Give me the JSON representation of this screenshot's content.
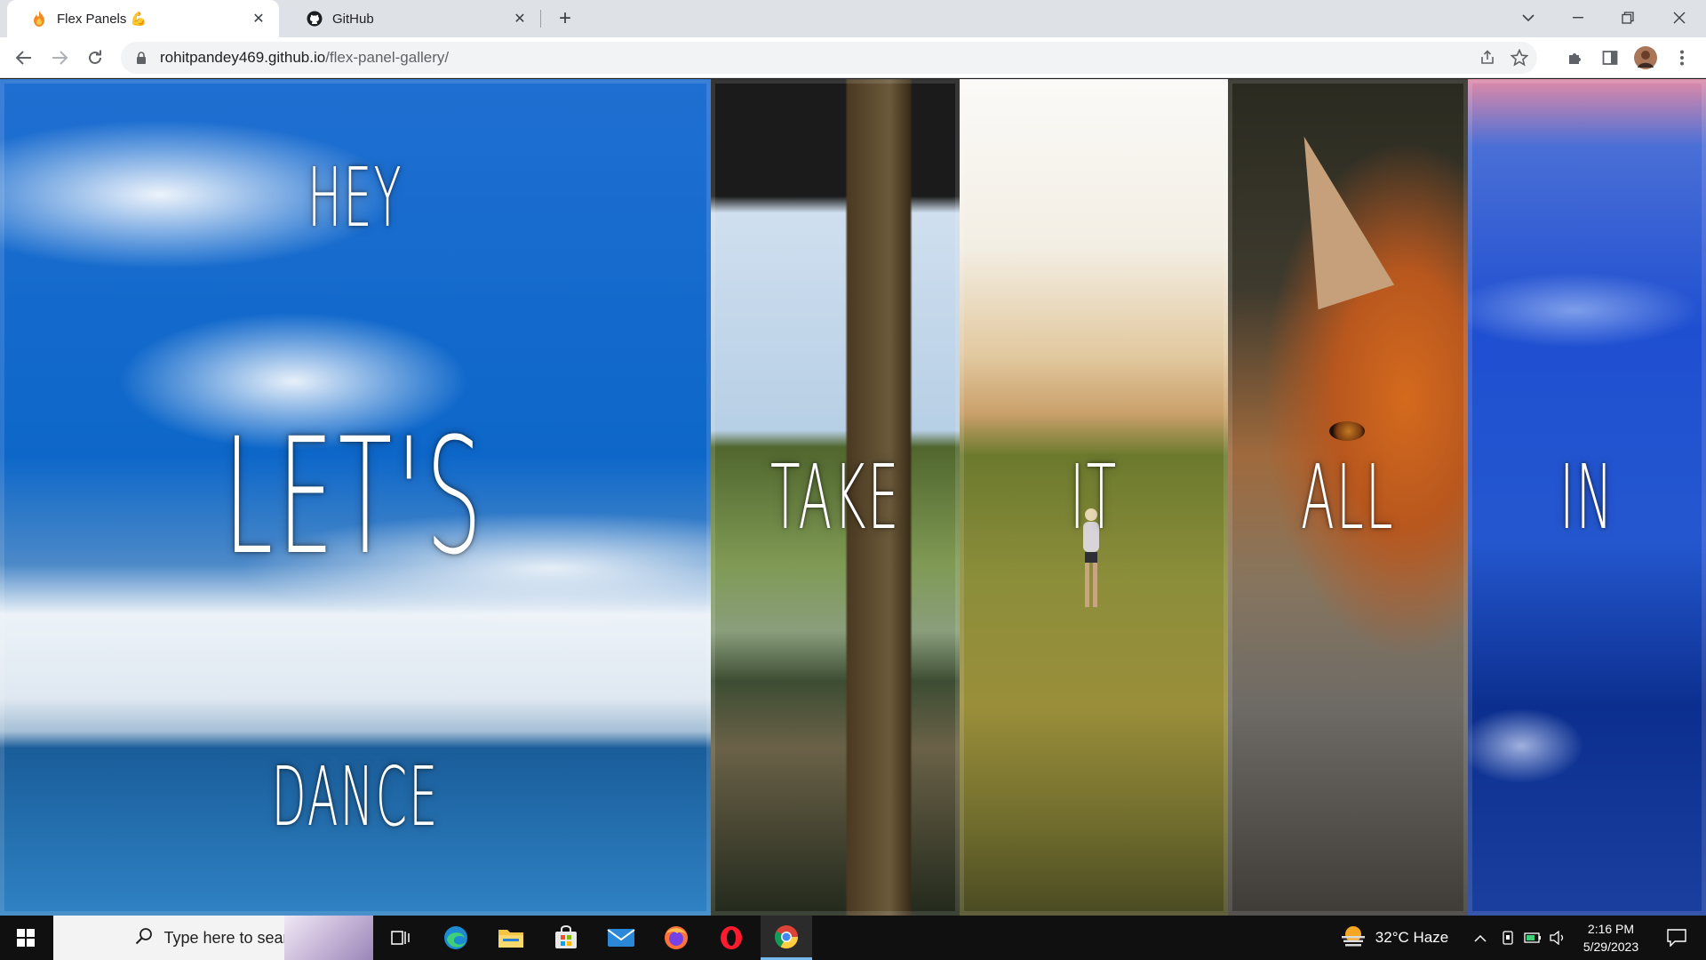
{
  "browser": {
    "tabs": [
      {
        "title": "Flex Panels 💪",
        "favicon": "fire-icon",
        "active": true
      },
      {
        "title": "GitHub",
        "favicon": "github-icon",
        "active": false
      }
    ],
    "url_domain": "rohitpandey469.github.io",
    "url_path": "/flex-panel-gallery/"
  },
  "gallery": {
    "panels": [
      {
        "top": "Hey",
        "middle": "Let's",
        "bottom": "Dance",
        "open": true
      },
      {
        "top": "",
        "middle": "Take",
        "bottom": "",
        "open": false
      },
      {
        "top": "",
        "middle": "It",
        "bottom": "",
        "open": false
      },
      {
        "top": "",
        "middle": "All",
        "bottom": "",
        "open": false
      },
      {
        "top": "",
        "middle": "In",
        "bottom": "",
        "open": false
      }
    ]
  },
  "taskbar": {
    "search_placeholder": "Type here to search",
    "apps": [
      "task-view-icon",
      "edge-icon",
      "file-explorer-icon",
      "store-icon",
      "mail-icon",
      "firefox-icon",
      "opera-icon",
      "chrome-icon"
    ],
    "weather": "32°C  Haze",
    "time": "2:16 PM",
    "date": "5/29/2023"
  },
  "colors": {
    "tabstrip": "#dee1e6",
    "taskbar": "#101010",
    "accent": "#76b9ed"
  }
}
